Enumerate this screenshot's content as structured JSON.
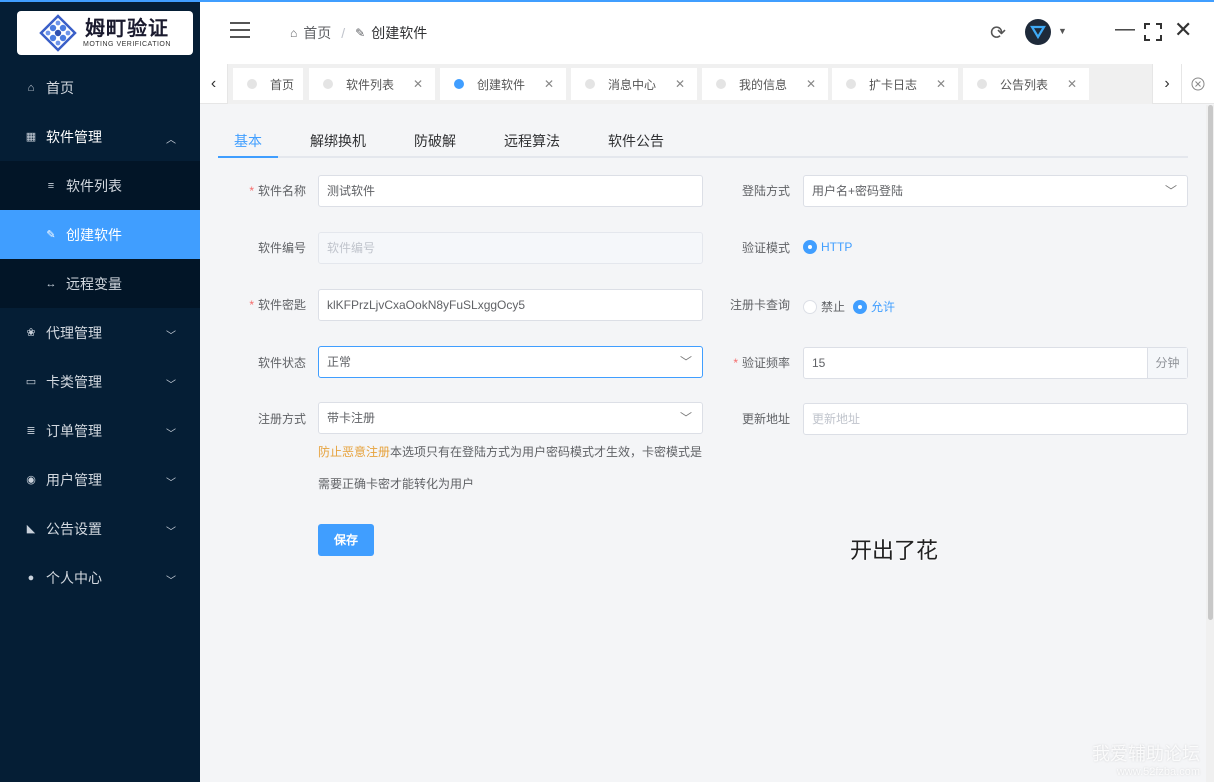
{
  "colors": {
    "accent": "#409eff",
    "sidebar_bg": "#051e35",
    "required": "#f56c6c",
    "warning": "#e6a23c"
  },
  "logo": {
    "title": "姆町验证",
    "subtitle": "MOTING VERIFICATION"
  },
  "sidebar": {
    "items": [
      {
        "label": "首页",
        "icon": "home-icon"
      },
      {
        "label": "软件管理",
        "icon": "grid-icon",
        "expanded": true,
        "children": [
          {
            "label": "软件列表",
            "icon": "list-icon"
          },
          {
            "label": "创建软件",
            "icon": "edit-icon",
            "active": true
          },
          {
            "label": "远程变量",
            "icon": "code-icon"
          }
        ]
      },
      {
        "label": "代理管理",
        "icon": "group-icon"
      },
      {
        "label": "卡类管理",
        "icon": "card-icon"
      },
      {
        "label": "订单管理",
        "icon": "order-icon"
      },
      {
        "label": "用户管理",
        "icon": "user-group-icon"
      },
      {
        "label": "公告设置",
        "icon": "rss-icon"
      },
      {
        "label": "个人中心",
        "icon": "person-icon"
      }
    ]
  },
  "header": {
    "breadcrumb": {
      "home": "首页",
      "separator": "/",
      "current": "创建软件"
    }
  },
  "tabs": [
    {
      "label": "首页",
      "active": false
    },
    {
      "label": "软件列表",
      "active": false
    },
    {
      "label": "创建软件",
      "active": true
    },
    {
      "label": "消息中心",
      "active": false
    },
    {
      "label": "我的信息",
      "active": false
    },
    {
      "label": "扩卡日志",
      "active": false
    },
    {
      "label": "公告列表",
      "active": false
    }
  ],
  "form_tabs": [
    "基本",
    "解绑换机",
    "防破解",
    "远程算法",
    "软件公告"
  ],
  "form": {
    "software_name": {
      "label": "软件名称",
      "value": "测试软件"
    },
    "software_id": {
      "label": "软件编号",
      "placeholder": "软件编号"
    },
    "software_key": {
      "label": "软件密匙",
      "value": "klKFPrzLjvCxaOokN8yFuSLxggOcy5"
    },
    "software_status": {
      "label": "软件状态",
      "value": "正常"
    },
    "register_mode": {
      "label": "注册方式",
      "value": "带卡注册"
    },
    "login_mode": {
      "label": "登陆方式",
      "value": "用户名+密码登陆"
    },
    "verify_mode": {
      "label": "验证模式",
      "option": "HTTP"
    },
    "card_query": {
      "label": "注册卡查询",
      "options": [
        "禁止",
        "允许"
      ],
      "selected": "允许"
    },
    "verify_freq": {
      "label": "验证频率",
      "value": "15",
      "unit": "分钟"
    },
    "update_url": {
      "label": "更新地址",
      "placeholder": "更新地址"
    },
    "hint_warn": "防止恶意注册",
    "hint_text1": "本选项只有在登陆方式为用户密码模式才生效，卡密模式是",
    "hint_text2": "需要正确卡密才能转化为用户",
    "save_label": "保存"
  },
  "overlay_text": "开出了花",
  "watermark": {
    "line1": "我爱辅助论坛",
    "line2": "www.52fzba.com"
  }
}
